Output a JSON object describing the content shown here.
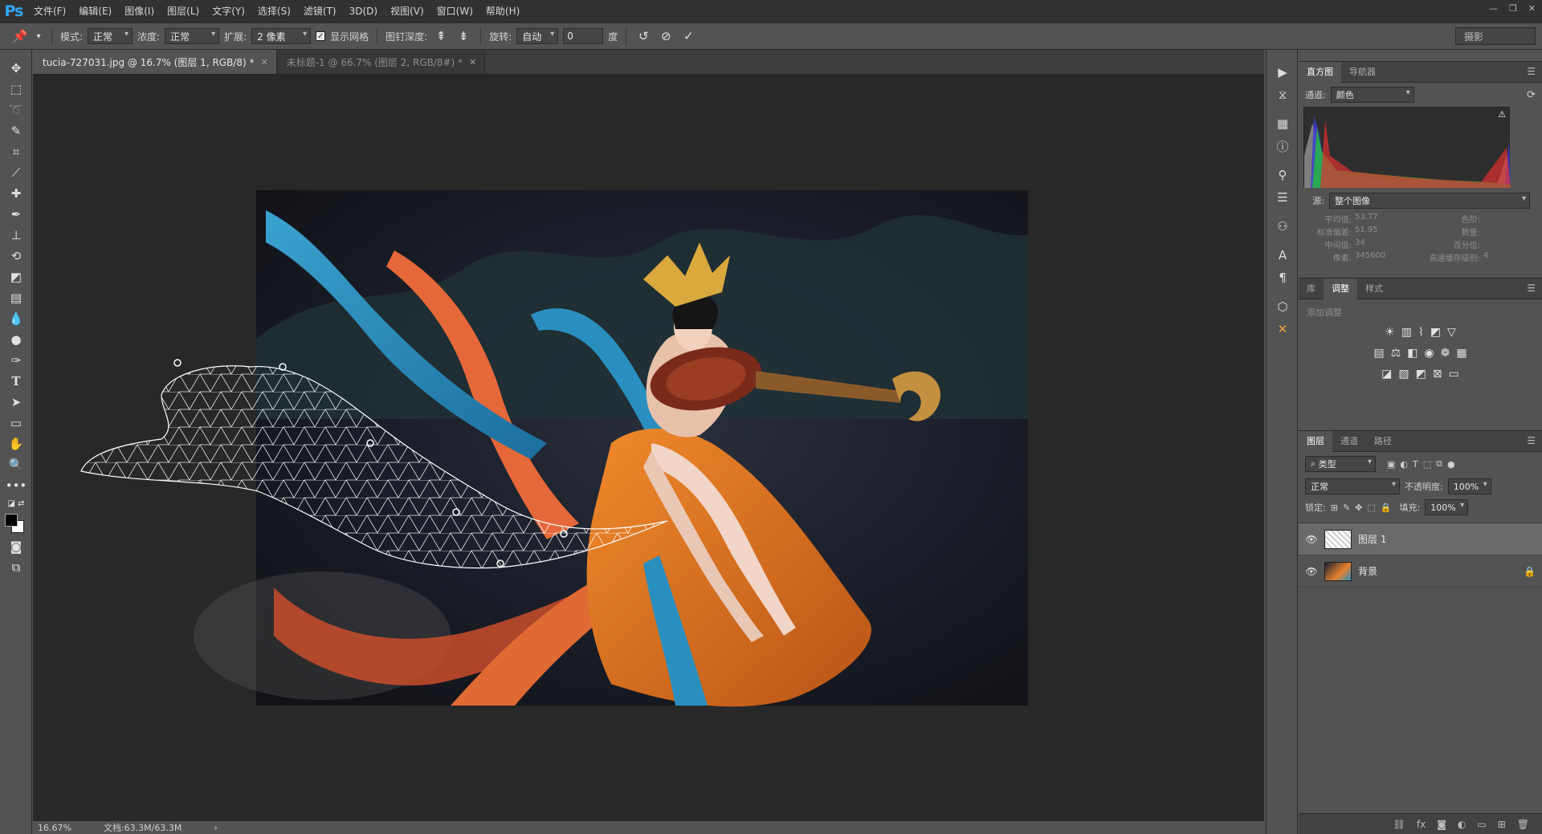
{
  "menubar": {
    "logo": "Ps",
    "items": [
      "文件(F)",
      "编辑(E)",
      "图像(I)",
      "图层(L)",
      "文字(Y)",
      "选择(S)",
      "滤镜(T)",
      "3D(D)",
      "视图(V)",
      "窗口(W)",
      "帮助(H)"
    ],
    "controls": [
      "—",
      "❐",
      "✕"
    ]
  },
  "options": {
    "mode_label": "模式:",
    "mode_value": "正常",
    "density_label": "浓度:",
    "density_value": "正常",
    "expand_label": "扩展:",
    "expand_value": "2 像素",
    "show_mesh_label": "显示网格",
    "pin_depth_label": "图钉深度:",
    "rotate_label": "旋转:",
    "rotate_value": "自动",
    "angle_value": "0",
    "angle_unit": "度",
    "workspace": "摄影"
  },
  "tabs": [
    {
      "label": "tucia-727031.jpg @ 16.7% (图层 1, RGB/8) *",
      "active": true
    },
    {
      "label": "未标题-1 @ 66.7% (图层 2, RGB/8#) *",
      "active": false
    }
  ],
  "status": {
    "zoom": "16.67%",
    "doc": "文档:63.3M/63.3M",
    "arrow": "›"
  },
  "histogram": {
    "tabs": [
      "直方图",
      "导航器"
    ],
    "channel_label": "通道:",
    "channel_value": "颜色",
    "source_label": "源:",
    "source_value": "整个图像",
    "stats": {
      "mean_label": "平均值:",
      "mean": "53.77",
      "std_label": "标准偏差:",
      "std": "51.95",
      "median_label": "中间值:",
      "median": "34",
      "pixels_label": "像素:",
      "pixels": "345600",
      "level_label": "色阶:",
      "count_label": "数量:",
      "percentile_label": "百分位:",
      "cache_label": "高速缓存级别:",
      "cache": "4"
    }
  },
  "adjustments": {
    "tabs": [
      "库",
      "调整",
      "样式"
    ],
    "add_label": "添加调整"
  },
  "layers": {
    "tabs": [
      "图层",
      "通道",
      "路径"
    ],
    "kind_value": "类型",
    "blend_value": "正常",
    "opacity_label": "不透明度:",
    "opacity": "100%",
    "lock_label": "锁定:",
    "fill_label": "填充:",
    "fill": "100%",
    "items": [
      {
        "name": "图层 1",
        "selected": true
      },
      {
        "name": "背景",
        "selected": false
      }
    ]
  },
  "colors": {
    "accent": "#31a8ff",
    "ribbon_blue": "#2a8fbf",
    "ribbon_orange": "#e5683a",
    "dress_orange": "#e8812d"
  }
}
